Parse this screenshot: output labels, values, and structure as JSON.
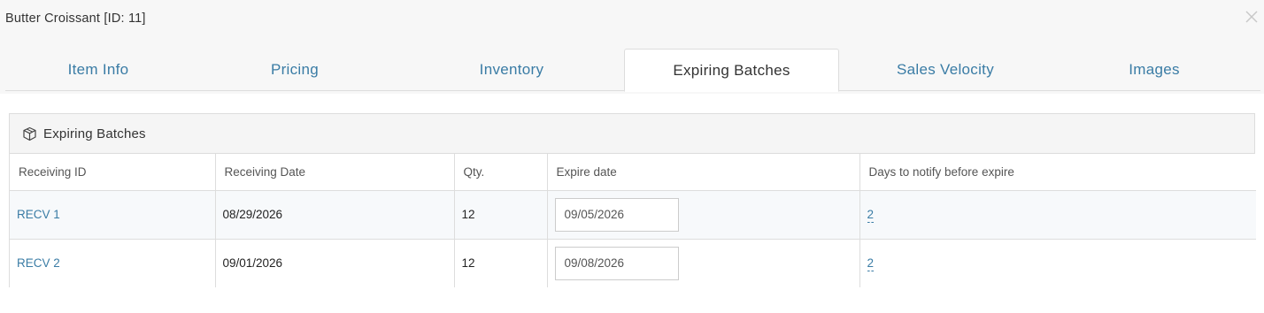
{
  "modal": {
    "title": "Butter Croissant [ID: 11]",
    "close_icon": "close-icon"
  },
  "tabs": [
    {
      "label": "Item Info",
      "active": false
    },
    {
      "label": "Pricing",
      "active": false
    },
    {
      "label": "Inventory",
      "active": false
    },
    {
      "label": "Expiring Batches",
      "active": true
    },
    {
      "label": "Sales Velocity",
      "active": false
    },
    {
      "label": "Images",
      "active": false
    }
  ],
  "panel": {
    "icon": "cube-icon",
    "title": "Expiring Batches"
  },
  "table": {
    "headers": [
      "Receiving ID",
      "Receiving Date",
      "Qty.",
      "Expire date",
      "Days to notify before expire"
    ],
    "rows": [
      {
        "receiving_id": "RECV 1",
        "receiving_date": "08/29/2026",
        "qty": "12",
        "expire_date": "09/05/2026",
        "days_notify": "2"
      },
      {
        "receiving_id": "RECV 2",
        "receiving_date": "09/01/2026",
        "qty": "12",
        "expire_date": "09/08/2026",
        "days_notify": "2"
      }
    ]
  },
  "colors": {
    "link": "#3a7ca5",
    "header_bg": "#f7f7f7",
    "border": "#dddddd"
  }
}
